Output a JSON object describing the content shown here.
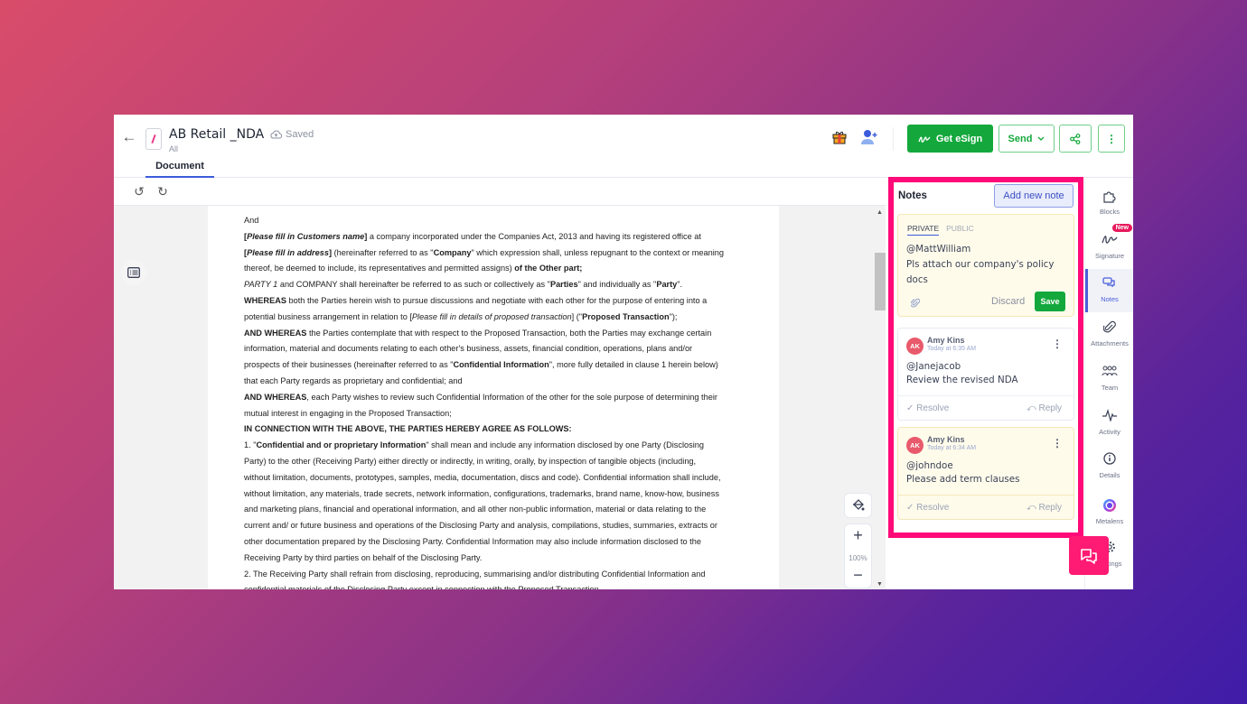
{
  "header": {
    "title": "AB Retail _NDA",
    "subtitle": "All",
    "status": "Saved",
    "tab": "Document",
    "buttons": {
      "esign": "Get eSign",
      "send": "Send"
    }
  },
  "colors": {
    "primary_green": "#14a83c",
    "highlight": "#ff0a78",
    "accent_blue": "#3b5bdb"
  },
  "document": {
    "zoom": "100%",
    "paragraphs": [
      [
        {
          "t": "And"
        }
      ],
      [
        {
          "t": "[",
          "b": 1
        },
        {
          "t": "Please fill in Customers name",
          "b": 1,
          "i": 1
        },
        {
          "t": "]",
          "b": 1
        },
        {
          "t": " a company incorporated under the Companies Act, 2013 and having its registered office at"
        }
      ],
      [
        {
          "t": "[",
          "b": 1
        },
        {
          "t": "Please fill in address",
          "b": 1,
          "i": 1
        },
        {
          "t": "]",
          "b": 1
        },
        {
          "t": " (hereinafter referred to as \""
        },
        {
          "t": "Company",
          "b": 1
        },
        {
          "t": "\" which expression shall, unless repugnant to the context or meaning"
        }
      ],
      [
        {
          "t": "thereof, be deemed to include, its representatives and permitted assigns) "
        },
        {
          "t": "of the Other part;",
          "b": 1
        }
      ],
      [
        {
          "t": "PARTY 1",
          "i": 1
        },
        {
          "t": " and COMPANY shall hereinafter be referred to as such or collectively as \""
        },
        {
          "t": "Parties",
          "b": 1
        },
        {
          "t": "\" and individually as \""
        },
        {
          "t": "Party",
          "b": 1
        },
        {
          "t": "\"."
        }
      ],
      [
        {
          "t": "WHEREAS",
          "b": 1
        },
        {
          "t": " both the Parties herein wish to pursue discussions and negotiate with each other for the purpose of entering into a"
        }
      ],
      [
        {
          "t": "potential business arrangement in relation to ["
        },
        {
          "t": "Please fill in details of proposed transaction",
          "i": 1
        },
        {
          "t": "] (\""
        },
        {
          "t": "Proposed Transaction",
          "b": 1
        },
        {
          "t": "\");"
        }
      ],
      [
        {
          "t": "AND WHEREAS",
          "b": 1
        },
        {
          "t": " the Parties contemplate that with respect to the Proposed Transaction, both the Parties may exchange certain"
        }
      ],
      [
        {
          "t": "information, material and documents relating to each other's business, assets, financial condition, operations, plans and/or"
        }
      ],
      [
        {
          "t": "prospects of their businesses (hereinafter referred to as \""
        },
        {
          "t": "Confidential Information",
          "b": 1
        },
        {
          "t": "\", more fully detailed in clause 1 herein below)"
        }
      ],
      [
        {
          "t": "that each Party regards as proprietary and confidential; and"
        }
      ],
      [
        {
          "t": "AND WHEREAS",
          "b": 1
        },
        {
          "t": ", each Party wishes to review such Confidential Information of the other for the sole purpose of determining their"
        }
      ],
      [
        {
          "t": "mutual interest in engaging in the Proposed Transaction;"
        }
      ],
      [
        {
          "t": "IN CONNECTION WITH THE ABOVE, THE PARTIES HEREBY AGREE AS FOLLOWS:",
          "b": 1
        }
      ],
      [
        {
          "t": "1. \""
        },
        {
          "t": "Confidential and or proprietary Information",
          "b": 1
        },
        {
          "t": "\" shall mean and include any information disclosed by one Party (Disclosing"
        }
      ],
      [
        {
          "t": "Party) to the other (Receiving Party) either directly or indirectly, in writing, orally, by inspection of tangible objects (including,"
        }
      ],
      [
        {
          "t": "without limitation, documents, prototypes, samples, media, documentation, discs and code). Confidential information shall include,"
        }
      ],
      [
        {
          "t": "without limitation, any materials, trade secrets, network information, configurations, trademarks, brand name, know-how, business"
        }
      ],
      [
        {
          "t": "and marketing plans, financial and operational information, and all other non-public information, material or data relating to the"
        }
      ],
      [
        {
          "t": "current and/ or future business and operations of the Disclosing Party and analysis, compilations, studies, summaries, extracts or"
        }
      ],
      [
        {
          "t": "other documentation prepared by the Disclosing Party. Confidential Information may also include information disclosed to the"
        }
      ],
      [
        {
          "t": "Receiving Party by third parties on behalf of the Disclosing Party."
        }
      ],
      [
        {
          "t": "2. The Receiving Party shall refrain from disclosing, reproducing, summarising and/or distributing Confidential Information and"
        }
      ],
      [
        {
          "t": "confidential materials of the Disclosing Party except in connection with the Proposed Transaction."
        }
      ]
    ]
  },
  "notes": {
    "title": "Notes",
    "add_button": "Add new note",
    "editor": {
      "tab_private": "PRIVATE",
      "tab_public": "PUBLIC",
      "mention": "@MattWilliam",
      "text": "Pls attach our company's policy docs",
      "discard": "Discard",
      "save": "Save"
    },
    "comments": [
      {
        "initials": "AK",
        "author": "Amy Kins",
        "time": "Today at 6:35 AM",
        "mention": "@Janejacob",
        "text": "Review the revised NDA",
        "resolve": "Resolve",
        "reply": "Reply"
      },
      {
        "initials": "AK",
        "author": "Amy Kins",
        "time": "Today at 6:34 AM",
        "mention": "@johndoe",
        "text": "Please add term clauses",
        "resolve": "Resolve",
        "reply": "Reply"
      }
    ]
  },
  "rail": {
    "items": [
      {
        "label": "Blocks",
        "icon": "puzzle-icon"
      },
      {
        "label": "Signature",
        "icon": "signature-icon",
        "badge": "New"
      },
      {
        "label": "Notes",
        "icon": "notes-icon",
        "active": true
      },
      {
        "label": "Attachments",
        "icon": "paperclip-icon"
      },
      {
        "label": "Team",
        "icon": "team-icon"
      },
      {
        "label": "Activity",
        "icon": "activity-icon"
      },
      {
        "label": "Details",
        "icon": "info-icon"
      },
      {
        "label": "Metalens",
        "icon": "metalens-icon"
      },
      {
        "label": "Settings",
        "icon": "gear-icon"
      }
    ]
  }
}
